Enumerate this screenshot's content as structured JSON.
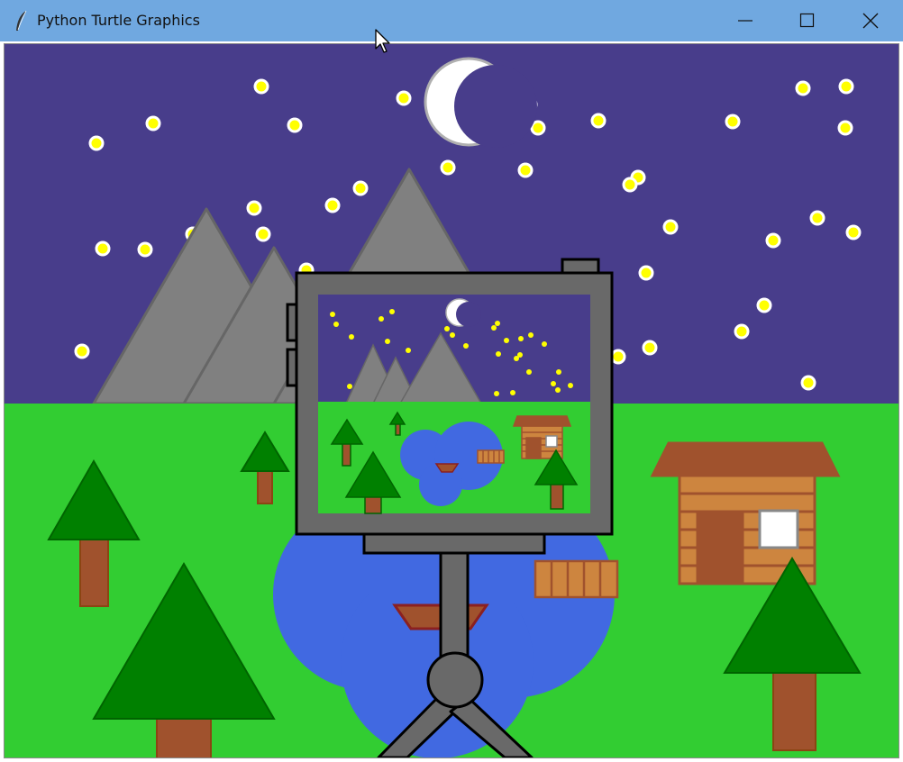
{
  "window": {
    "title": "Python Turtle Graphics",
    "icon": "feather-icon",
    "controls": [
      "minimize-icon",
      "maximize-icon",
      "close-icon"
    ]
  },
  "colors": {
    "titlebar": "#70a8e0",
    "sky": "#483d8b",
    "grass": "#32cd32",
    "mountain": "#808080",
    "lake": "#4169e1",
    "tree_green": "#008000",
    "trunk": "#a0522d",
    "cabin_wood": "#cd853f",
    "star": "#ffff00",
    "moon": "#ffffff",
    "camera": "#696969"
  },
  "scene": {
    "elements": [
      "sky",
      "stars",
      "moon",
      "mountains",
      "grass",
      "lake",
      "boat",
      "dock",
      "cabin",
      "trees",
      "camera-on-tripod"
    ]
  }
}
